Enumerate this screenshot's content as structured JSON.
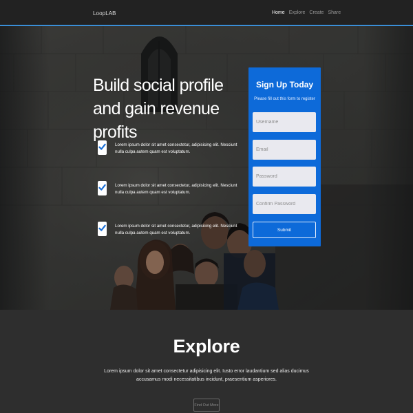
{
  "navbar": {
    "brand": "LoopLAB",
    "links": [
      {
        "label": "Home",
        "active": true
      },
      {
        "label": "Explore",
        "active": false
      },
      {
        "label": "Create",
        "active": false
      },
      {
        "label": "Share",
        "active": false
      }
    ]
  },
  "hero": {
    "title": "Build social profile and gain revenue profits",
    "features": [
      {
        "icon": "checkmark-icon",
        "text": "Lorem ipsum dolor sit amet consectetur, adipisicing elit. Nesciunt nulla culpa autem quam est voluptatum."
      },
      {
        "icon": "checkmark-icon",
        "text": "Lorem ipsum dolor sit amet consectetur, adipisicing elit. Nesciunt nulla culpa autem quam est voluptatum."
      },
      {
        "icon": "checkmark-icon",
        "text": "Lorem ipsum dolor sit amet consectetur, adipisicing elit. Nesciunt nulla culpa autem quam est voluptatum."
      }
    ]
  },
  "signup": {
    "title": "Sign Up Today",
    "subtitle": "Please fill out this form to register",
    "fields": {
      "username": {
        "placeholder": "Username",
        "value": ""
      },
      "email": {
        "placeholder": "Email",
        "value": ""
      },
      "password": {
        "placeholder": "Password",
        "value": ""
      },
      "confirm_password": {
        "placeholder": "Confirm Password",
        "value": ""
      }
    },
    "submit_label": "Submit"
  },
  "explore": {
    "title": "Explore",
    "text": "Lorem ipsum dolor sit amet consectetur adipisicing elit. Iusto error laudantium sed alias ducimus accusamus modi necessitatibus incidunt, praesentium asperiores.",
    "button_label": "Find Out More"
  },
  "colors": {
    "accent": "#0d6ad9",
    "nav_border": "#3a8fd8",
    "section_bg": "#2e2e2e"
  }
}
